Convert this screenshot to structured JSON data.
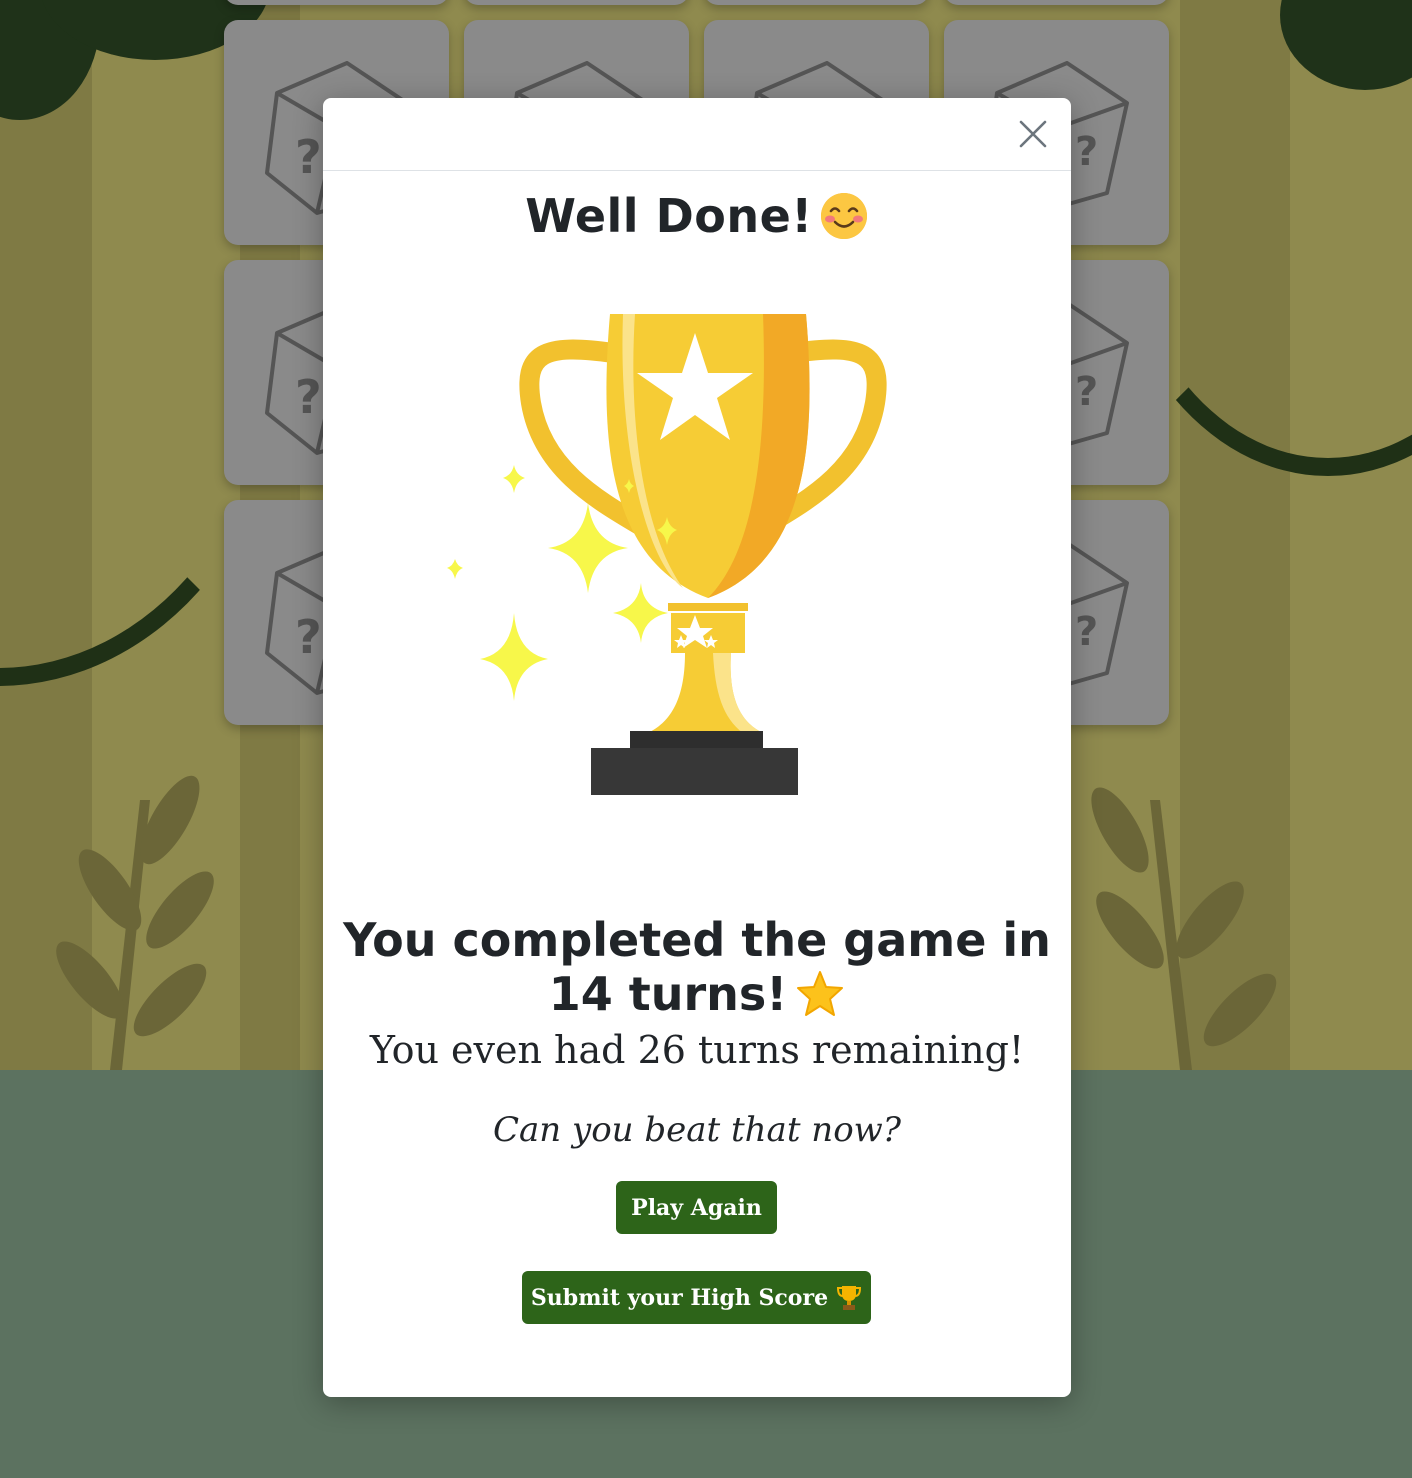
{
  "modal": {
    "title": "Well Done!",
    "title_emoji": "smiling-face-emoji",
    "completed_prefix": "You completed the game in",
    "turns_text": "14 turns!",
    "turns_emoji": "star-emoji",
    "remaining_text": "You even had 26 turns remaining!",
    "challenge_text": "Can you beat that now?",
    "close_icon": "close-icon",
    "trophy_image": "trophy-illustration"
  },
  "buttons": {
    "play_again": "Play Again",
    "submit_score": "Submit your High Score",
    "submit_icon": "trophy-icon"
  },
  "game": {
    "card_back_icon": "mystery-dice-icon"
  },
  "colors": {
    "button": "#2d6419",
    "card": "#8a8a8a",
    "background_bottom": "#5c7260",
    "background_scene": "#8f8a4e"
  }
}
